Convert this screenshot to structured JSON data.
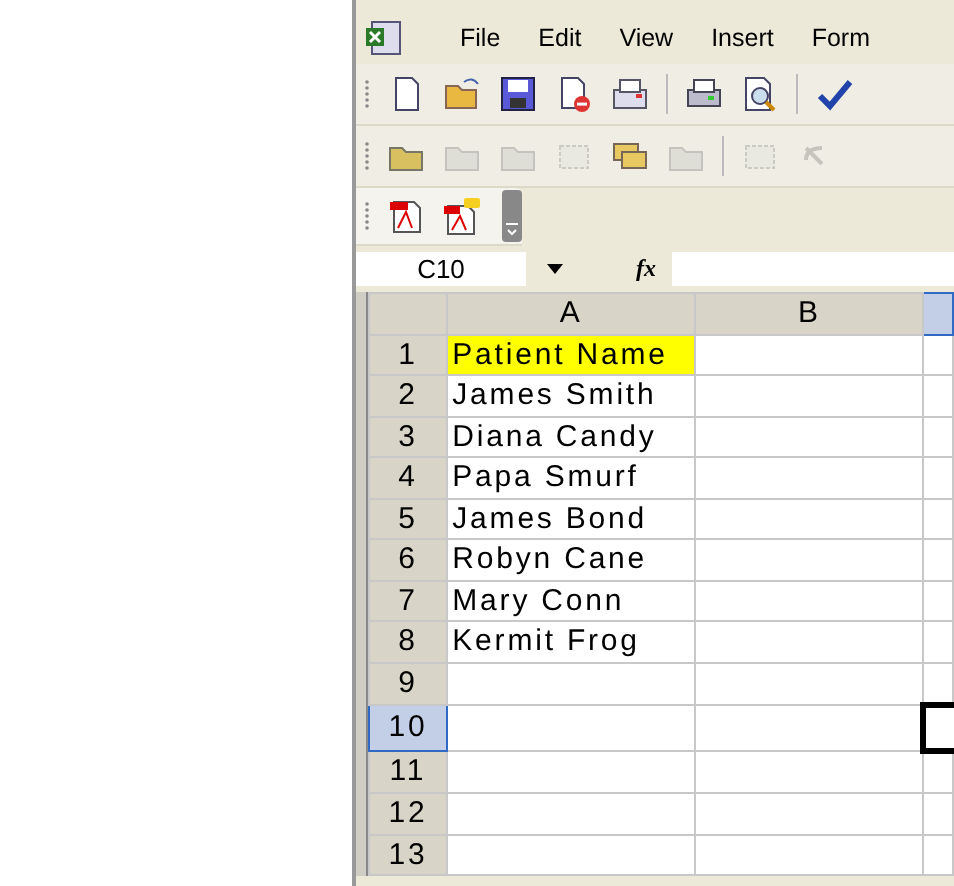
{
  "menu": [
    {
      "label": "File"
    },
    {
      "label": "Edit"
    },
    {
      "label": "View"
    },
    {
      "label": "Insert"
    },
    {
      "label": "Form"
    }
  ],
  "toolbars": [
    {
      "items": [
        {
          "kind": "new",
          "disabled": false
        },
        {
          "kind": "open",
          "disabled": false
        },
        {
          "kind": "save",
          "disabled": false
        },
        {
          "kind": "permission",
          "disabled": false
        },
        {
          "kind": "email",
          "disabled": false
        },
        {
          "kind": "sep"
        },
        {
          "kind": "print",
          "disabled": false
        },
        {
          "kind": "preview",
          "disabled": false
        },
        {
          "kind": "sep"
        },
        {
          "kind": "spelling",
          "disabled": false
        }
      ]
    },
    {
      "items": [
        {
          "kind": "folder",
          "disabled": false
        },
        {
          "kind": "folder",
          "disabled": true
        },
        {
          "kind": "folder",
          "disabled": true
        },
        {
          "kind": "frame",
          "disabled": true
        },
        {
          "kind": "stack",
          "disabled": false
        },
        {
          "kind": "folder",
          "disabled": true
        },
        {
          "kind": "sep"
        },
        {
          "kind": "frame",
          "disabled": true
        },
        {
          "kind": "undo",
          "disabled": true
        }
      ]
    },
    {
      "items": [
        {
          "kind": "pdf",
          "disabled": false
        },
        {
          "kind": "pdfnote",
          "disabled": false
        }
      ]
    }
  ],
  "name_box": {
    "value": "C10"
  },
  "formula_bar": {
    "fx": "fx"
  },
  "columns": [
    {
      "label": "A",
      "selected": false
    },
    {
      "label": "B",
      "selected": false
    },
    {
      "selected": true
    }
  ],
  "rows": [
    {
      "number": "1",
      "selected": false,
      "cells": [
        {
          "text": "Patient Name",
          "highlighted": true,
          "selected": false
        },
        {
          "text": "",
          "highlighted": false,
          "selected": false
        },
        {
          "text": "",
          "highlighted": false,
          "selected": false
        }
      ]
    },
    {
      "number": "2",
      "selected": false,
      "cells": [
        {
          "text": "James Smith",
          "highlighted": false,
          "selected": false
        },
        {
          "text": "",
          "highlighted": false,
          "selected": false
        },
        {
          "text": "",
          "highlighted": false,
          "selected": false
        }
      ]
    },
    {
      "number": "3",
      "selected": false,
      "cells": [
        {
          "text": "Diana Candy",
          "highlighted": false,
          "selected": false
        },
        {
          "text": "",
          "highlighted": false,
          "selected": false
        },
        {
          "text": "",
          "highlighted": false,
          "selected": false
        }
      ]
    },
    {
      "number": "4",
      "selected": false,
      "cells": [
        {
          "text": "Papa Smurf",
          "highlighted": false,
          "selected": false
        },
        {
          "text": "",
          "highlighted": false,
          "selected": false
        },
        {
          "text": "",
          "highlighted": false,
          "selected": false
        }
      ]
    },
    {
      "number": "5",
      "selected": false,
      "cells": [
        {
          "text": "James Bond",
          "highlighted": false,
          "selected": false
        },
        {
          "text": "",
          "highlighted": false,
          "selected": false
        },
        {
          "text": "",
          "highlighted": false,
          "selected": false
        }
      ]
    },
    {
      "number": "6",
      "selected": false,
      "cells": [
        {
          "text": "Robyn Cane",
          "highlighted": false,
          "selected": false
        },
        {
          "text": "",
          "highlighted": false,
          "selected": false
        },
        {
          "text": "",
          "highlighted": false,
          "selected": false
        }
      ]
    },
    {
      "number": "7",
      "selected": false,
      "cells": [
        {
          "text": "Mary Conn",
          "highlighted": false,
          "selected": false
        },
        {
          "text": "",
          "highlighted": false,
          "selected": false
        },
        {
          "text": "",
          "highlighted": false,
          "selected": false
        }
      ]
    },
    {
      "number": "8",
      "selected": false,
      "cells": [
        {
          "text": "Kermit Frog",
          "highlighted": false,
          "selected": false
        },
        {
          "text": "",
          "highlighted": false,
          "selected": false
        },
        {
          "text": "",
          "highlighted": false,
          "selected": false
        }
      ]
    },
    {
      "number": "9",
      "selected": false,
      "cells": [
        {
          "text": "",
          "highlighted": false,
          "selected": false
        },
        {
          "text": "",
          "highlighted": false,
          "selected": false
        },
        {
          "text": "",
          "highlighted": false,
          "selected": false
        }
      ]
    },
    {
      "number": "10",
      "selected": true,
      "cells": [
        {
          "text": "",
          "highlighted": false,
          "selected": false
        },
        {
          "text": "",
          "highlighted": false,
          "selected": false
        },
        {
          "text": "",
          "highlighted": false,
          "selected": true
        }
      ]
    },
    {
      "number": "11",
      "selected": false,
      "cells": [
        {
          "text": "",
          "highlighted": false,
          "selected": false
        },
        {
          "text": "",
          "highlighted": false,
          "selected": false
        },
        {
          "text": "",
          "highlighted": false,
          "selected": false
        }
      ]
    },
    {
      "number": "12",
      "selected": false,
      "cells": [
        {
          "text": "",
          "highlighted": false,
          "selected": false
        },
        {
          "text": "",
          "highlighted": false,
          "selected": false
        },
        {
          "text": "",
          "highlighted": false,
          "selected": false
        }
      ]
    },
    {
      "number": "13",
      "selected": false,
      "cells": [
        {
          "text": "",
          "highlighted": false,
          "selected": false
        },
        {
          "text": "",
          "highlighted": false,
          "selected": false
        },
        {
          "text": "",
          "highlighted": false,
          "selected": false
        }
      ]
    }
  ]
}
